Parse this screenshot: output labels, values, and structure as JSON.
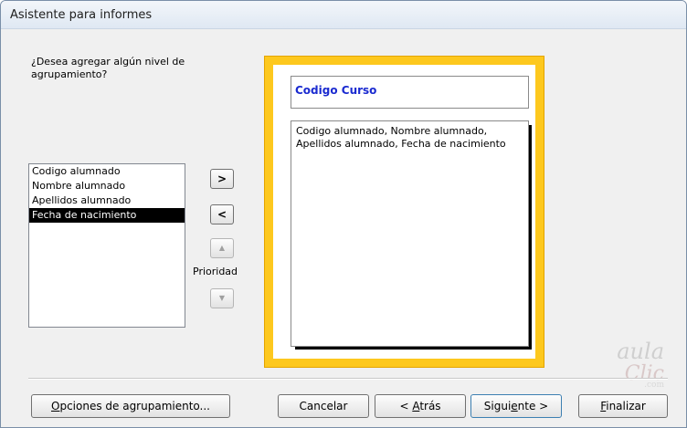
{
  "window": {
    "title": "Asistente para informes"
  },
  "question": "¿Desea agregar algún nivel de agrupamiento?",
  "fields": [
    {
      "label": "Codigo alumnado",
      "selected": false
    },
    {
      "label": "Nombre alumnado",
      "selected": false
    },
    {
      "label": "Apellidos alumnado",
      "selected": false
    },
    {
      "label": "Fecha de nacimiento",
      "selected": true
    }
  ],
  "buttons": {
    "add": ">",
    "remove": "<",
    "priority_up": "▲",
    "priority_down": "▼",
    "priority_label": "Prioridad"
  },
  "preview": {
    "group_header": "Codigo Curso",
    "detail_fields": "Codigo alumnado, Nombre alumnado, Apellidos alumnado, Fecha de nacimiento"
  },
  "footer": {
    "grouping_options": {
      "mnemonic": "O",
      "rest": "pciones de agrupamiento..."
    },
    "cancel": "Cancelar",
    "back": {
      "pre": "< ",
      "mnemonic": "A",
      "rest": "trás"
    },
    "next": {
      "pre": "Sigui",
      "mnemonic": "e",
      "rest": "nte >"
    },
    "finish": {
      "mnemonic": "F",
      "rest": "inalizar"
    }
  },
  "watermark": {
    "line1": "aula",
    "line2": "Clic",
    "line3": ".com"
  }
}
